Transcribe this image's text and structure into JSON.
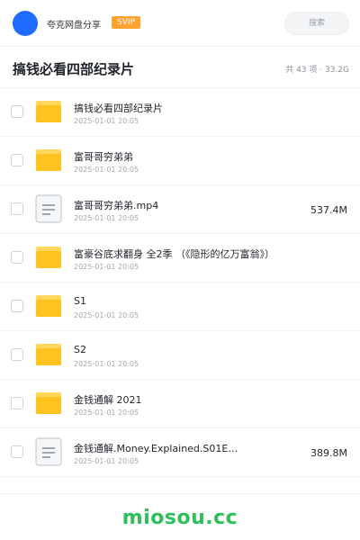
{
  "header": {
    "app_name": "夸克网盘分享",
    "badge": "SVIP",
    "search_placeholder": "搜索",
    "avatar_color": "#1d6bff"
  },
  "folder": {
    "title": "搞钱必看四部纪录片",
    "summary": "共 43 项 · 33.2G"
  },
  "files": [
    {
      "name": "搞钱必看四部纪录片",
      "date": "2025-01-01 20:05",
      "type": "folder",
      "size": ""
    },
    {
      "name": "富哥哥穷弟弟",
      "date": "2025-01-01 20:05",
      "type": "folder",
      "size": ""
    },
    {
      "name": "富哥哥穷弟弟.mp4",
      "date": "2025-01-01 20:05",
      "type": "file",
      "size": "537.4M"
    },
    {
      "name": "富豪谷底求翻身 全2季 （《隐形的亿万富翁》）",
      "date": "2025-01-01 20:05",
      "type": "folder",
      "size": ""
    },
    {
      "name": "S1",
      "date": "2025-01-01 20:05",
      "type": "folder",
      "size": ""
    },
    {
      "name": "S2",
      "date": "2025-01-01 20:05",
      "type": "folder",
      "size": ""
    },
    {
      "name": "金钱通解 2021",
      "date": "2025-01-01 20:05",
      "type": "folder",
      "size": ""
    },
    {
      "name": "金钱通解.Money.Explained.S01E…",
      "date": "2025-01-01 20:05",
      "type": "file",
      "size": "389.8M"
    }
  ],
  "footer": {
    "watermark": "miosou.cc",
    "watermark_color": "#2fbf5a"
  },
  "colors": {
    "folder": "#ffc31f",
    "folder_tab": "#ffd75a",
    "badge": "#ffa22e"
  }
}
